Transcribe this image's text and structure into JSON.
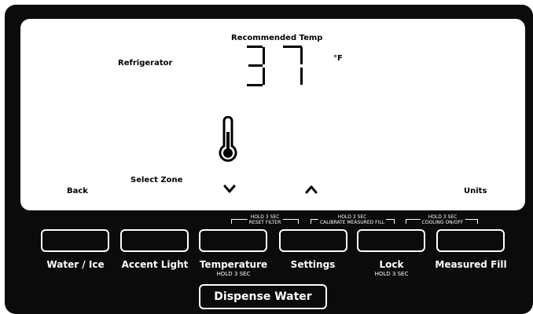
{
  "display": {
    "recommended_label": "Recommended Temp",
    "zone_label": "Refrigerator",
    "temperature_value": "37",
    "unit": "°F",
    "select_zone_label": "Select Zone",
    "back_label": "Back",
    "units_label": "Units",
    "icons": [
      "thermometer-icon",
      "chevron-down-icon",
      "chevron-up-icon"
    ]
  },
  "hold_labels": [
    {
      "line1": "HOLD 3 SEC",
      "line2": "RESET FILTER"
    },
    {
      "line1": "HOLD 3 SEC",
      "line2": "CALIBRATE MEASURED FILL"
    },
    {
      "line1": "HOLD 3 SEC",
      "line2": "COOLING ON/OFF"
    }
  ],
  "buttons": [
    {
      "label": "Water / Ice",
      "sub": ""
    },
    {
      "label": "Accent Light",
      "sub": ""
    },
    {
      "label": "Temperature",
      "sub": "HOLD 3 SEC"
    },
    {
      "label": "Settings",
      "sub": ""
    },
    {
      "label": "Lock",
      "sub": "HOLD 3 SEC"
    },
    {
      "label": "Measured Fill",
      "sub": ""
    }
  ],
  "dispense": {
    "label": "Dispense Water"
  },
  "colors": {
    "panel": "#0b0b0b",
    "screen": "#ffffff",
    "text_on_panel": "#ffffff"
  }
}
